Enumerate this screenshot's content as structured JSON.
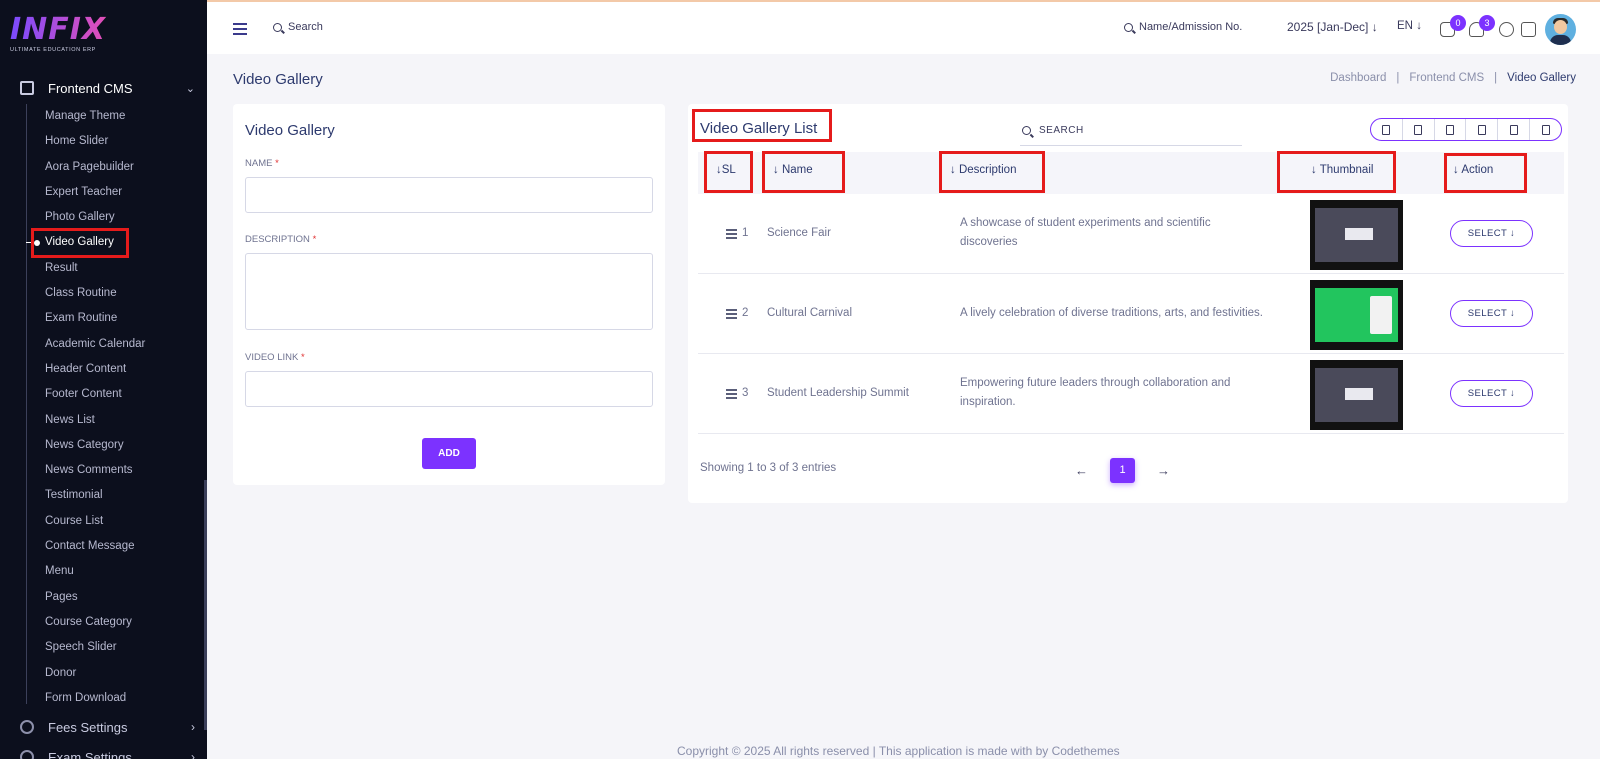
{
  "brand": {
    "logo": "INFIX",
    "tagline": "ULTIMATE EDUCATION ERP"
  },
  "sidebar": {
    "group_label": "Frontend CMS",
    "items": [
      {
        "label": "Manage Theme"
      },
      {
        "label": "Home Slider"
      },
      {
        "label": "Aora Pagebuilder"
      },
      {
        "label": "Expert Teacher"
      },
      {
        "label": "Photo Gallery"
      },
      {
        "label": "Video Gallery"
      },
      {
        "label": "Result"
      },
      {
        "label": "Class Routine"
      },
      {
        "label": "Exam Routine"
      },
      {
        "label": "Academic Calendar"
      },
      {
        "label": "Header Content"
      },
      {
        "label": "Footer Content"
      },
      {
        "label": "News List"
      },
      {
        "label": "News Category"
      },
      {
        "label": "News Comments"
      },
      {
        "label": "Testimonial"
      },
      {
        "label": "Course List"
      },
      {
        "label": "Contact Message"
      },
      {
        "label": "Menu"
      },
      {
        "label": "Pages"
      },
      {
        "label": "Course Category"
      },
      {
        "label": "Speech Slider"
      },
      {
        "label": "Donor"
      },
      {
        "label": "Form Download"
      }
    ],
    "active": "Video Gallery",
    "bottom_groups": [
      {
        "label": "Fees Settings"
      },
      {
        "label": "Exam Settings"
      }
    ]
  },
  "topbar": {
    "search_label": "Search",
    "admission_search": "Name/Admission No.",
    "session": "2025 [Jan-Dec]",
    "language": "EN",
    "messages_count": "0",
    "notifications_count": "3"
  },
  "page": {
    "title": "Video Gallery",
    "breadcrumb": [
      "Dashboard",
      "Frontend CMS",
      "Video Gallery"
    ]
  },
  "form": {
    "title": "Video Gallery",
    "name_label": "NAME",
    "description_label": "DESCRIPTION",
    "video_link_label": "VIDEO LINK",
    "required_mark": "*",
    "add_button": "ADD"
  },
  "list": {
    "title": "Video Gallery List",
    "search_placeholder": "SEARCH",
    "columns": {
      "sl": "SL",
      "name": "Name",
      "description": "Description",
      "thumbnail": "Thumbnail",
      "action": "Action"
    },
    "rows": [
      {
        "sl": "1",
        "name": "Science Fair",
        "description": "A showcase of student experiments and scientific discoveries",
        "thumbnail_style": "dark",
        "action": "SELECT"
      },
      {
        "sl": "2",
        "name": "Cultural Carnival",
        "description": "A lively celebration of diverse traditions, arts, and festivities.",
        "thumbnail_style": "green",
        "action": "SELECT"
      },
      {
        "sl": "3",
        "name": "Student Leadership Summit",
        "description": "Empowering future leaders through collaboration and inspiration.",
        "thumbnail_style": "dark",
        "action": "SELECT"
      }
    ],
    "showing": "Showing 1 to 3 of 3 entries",
    "current_page": "1"
  },
  "footer": "Copyright © 2025 All rights reserved | This application is made with by Codethemes",
  "colors": {
    "accent": "#7c32ff",
    "highlight": "#e51b1b",
    "sidebar_bg": "#0c0f1d"
  }
}
